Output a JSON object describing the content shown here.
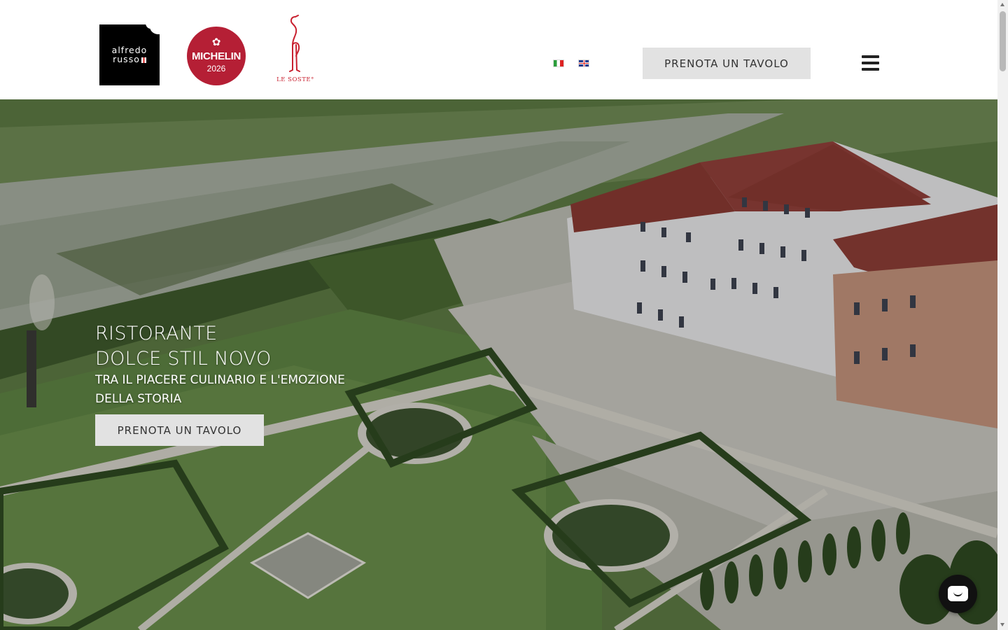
{
  "header": {
    "logo_line1": "alfredo",
    "logo_line2": "russo",
    "michelin_name": "MICHELIN",
    "michelin_year": "2026",
    "lesoste_name": "LE SOSTE°",
    "languages": [
      {
        "code": "it",
        "icon": "italian-flag-icon"
      },
      {
        "code": "en",
        "icon": "uk-flag-icon"
      }
    ],
    "reserve_label": "PRENOTA UN TAVOLO",
    "menu_icon": "hamburger-menu-icon"
  },
  "hero": {
    "title_line1": "RISTORANTE",
    "title_line2": "DOLCE STIL NOVO",
    "subtitle_line1": "TRA IL PIACERE CULINARIO E L'EMOZIONE",
    "subtitle_line2": "DELLA STORIA",
    "reserve_label": "PRENOTA UN TAVOLO"
  },
  "chat": {
    "icon": "chat-bubble-icon"
  },
  "colors": {
    "michelin_red": "#b51f35",
    "lesoste_red": "#c8202f",
    "button_bg": "#e2e2e2",
    "button_text": "#333333"
  }
}
